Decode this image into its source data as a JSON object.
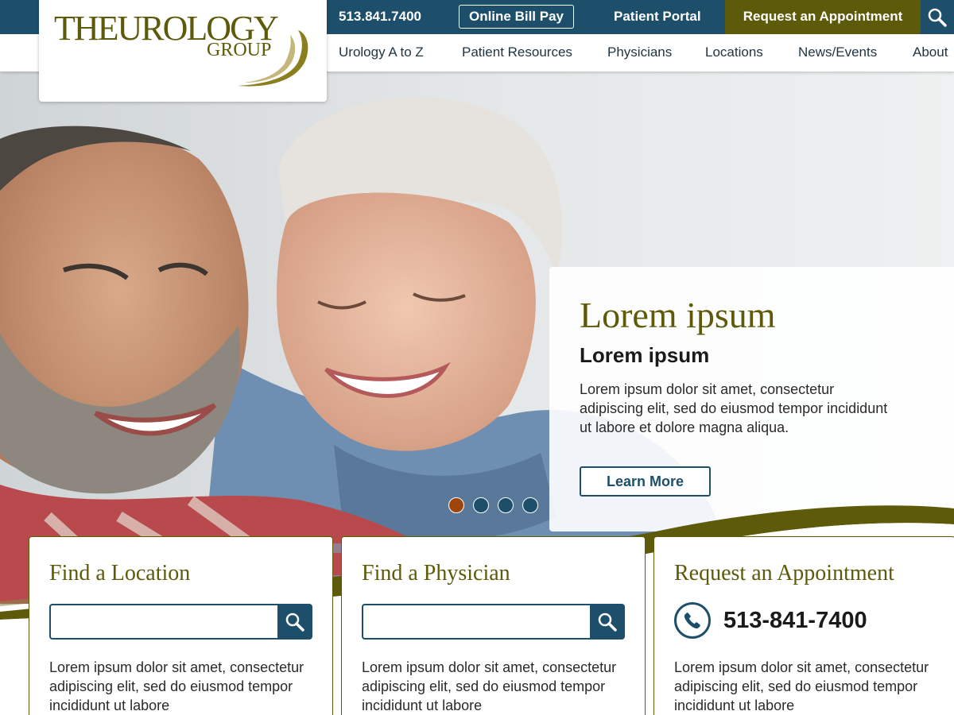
{
  "header": {
    "phone": "513.841.7400",
    "bill_pay": "Online Bill Pay",
    "patient_portal": "Patient Portal",
    "request_appointment": "Request an Appointment",
    "search_icon": "search-icon"
  },
  "logo": {
    "line1": "THEUROLOGY",
    "line2": "GROUP"
  },
  "nav": {
    "items": [
      "Urology A to Z",
      "Patient Resources",
      "Physicians",
      "Locations",
      "News/Events",
      "About"
    ]
  },
  "hero": {
    "heading": "Lorem ipsum",
    "subheading": "Lorem ipsum",
    "text": "Lorem ipsum dolor sit amet, consectetur adipiscing elit, sed do eiusmod tempor incididunt ut labore et dolore magna aliqua.",
    "button": "Learn More",
    "slides_total": 4,
    "active_slide": 1
  },
  "cards": {
    "location": {
      "title": "Find a Location",
      "text": "Lorem ipsum dolor sit amet, consectetur adipiscing elit, sed do eiusmod tempor incididunt ut labore"
    },
    "physician": {
      "title": "Find a Physician",
      "text": "Lorem ipsum dolor sit amet, consectetur adipiscing elit, sed do eiusmod tempor incididunt ut labore"
    },
    "appointment": {
      "title": "Request an Appointment",
      "phone": "513-841-7400",
      "text": "Lorem ipsum dolor sit amet, consectetur adipiscing elit, sed do eiusmod tempor incididunt ut labore"
    }
  },
  "colors": {
    "primary_blue": "#1d4f6b",
    "olive": "#5d5a0a",
    "active_dot": "#a0450a"
  }
}
